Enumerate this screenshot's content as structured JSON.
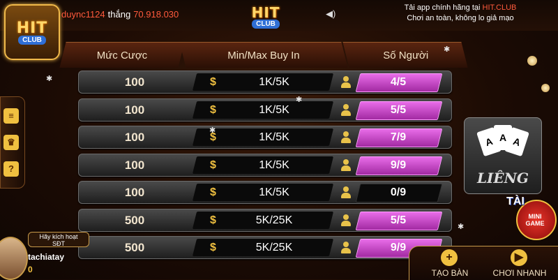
{
  "header": {
    "username": "duync1124",
    "win_verb": "thắng",
    "win_amount": "70.918.030",
    "logo_text": "HIT",
    "logo_sub": "CLUB",
    "promo_line1_prefix": "Tải app chính hãng tại ",
    "promo_line1_brand": "HIT.CLUB",
    "promo_line2": "Chơi an toàn, không lo giả mạo"
  },
  "columns": {
    "bet": "Mức Cược",
    "buyin": "Min/Max Buy In",
    "players": "Số Người"
  },
  "rooms": [
    {
      "bet": "100",
      "buyin": "1K/5K",
      "players": "4/5",
      "full": true
    },
    {
      "bet": "100",
      "buyin": "1K/5K",
      "players": "5/5",
      "full": true
    },
    {
      "bet": "100",
      "buyin": "1K/5K",
      "players": "7/9",
      "full": true
    },
    {
      "bet": "100",
      "buyin": "1K/5K",
      "players": "9/9",
      "full": true
    },
    {
      "bet": "100",
      "buyin": "1K/5K",
      "players": "0/9",
      "full": false
    },
    {
      "bet": "500",
      "buyin": "5K/25K",
      "players": "5/5",
      "full": true
    },
    {
      "bet": "500",
      "buyin": "5K/25K",
      "players": "9/9",
      "full": true
    }
  ],
  "currency_symbol": "$",
  "side_icons": [
    "list-icon",
    "trophy-icon",
    "help-icon"
  ],
  "game_tile": {
    "name": "LIÊNG",
    "cards": [
      "A",
      "A",
      "A"
    ]
  },
  "mini_game": {
    "tai": "TÀI",
    "label_line1": "MINI",
    "label_line2": "GAME"
  },
  "player": {
    "activate_line1": "Hãy kích hoạt",
    "activate_line2": "SĐT",
    "name": "tachiatay",
    "balance": "0"
  },
  "actions": {
    "create_table": "TẠO BÀN",
    "quick_play": "CHƠI NHANH"
  },
  "colors": {
    "accent": "#e86ce8",
    "gold": "#f0c040",
    "highlight": "#ff5a3c"
  }
}
